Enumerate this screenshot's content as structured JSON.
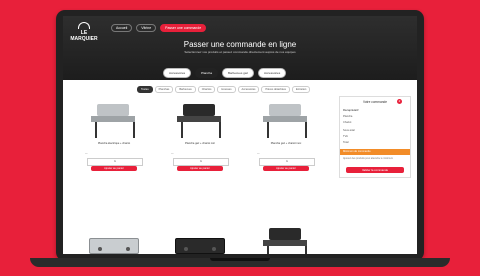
{
  "header": {
    "logo": "LE MARQUIER",
    "nav": [
      "Accueil",
      "Vitrine",
      "Passer une commande"
    ],
    "title": "Passer une commande en ligne",
    "subtitle": "Sélectionnez vos produits et passez commande directement auprès de nos équipes"
  },
  "tabs": [
    "Accessoires",
    "Plancha",
    "Barbecues gaz",
    "Accessoires"
  ],
  "filters": [
    "Toutes",
    "Planchas",
    "Barbecues",
    "Chariots",
    "Housses",
    "Accessoires",
    "Pièces détachées",
    "Entretien"
  ],
  "products": [
    {
      "title": "Plancha électrique + chariot",
      "price": "—",
      "qty": "1",
      "button": "Ajouter au panier"
    },
    {
      "title": "Plancha gaz + chariot noir",
      "price": "—",
      "qty": "1",
      "button": "Ajouter au panier"
    },
    {
      "title": "Plancha gaz + chariot inox",
      "price": "—",
      "qty": "1",
      "button": "Ajouter au panier"
    }
  ],
  "cart": {
    "title": "Votre commande",
    "count": "2",
    "section": "Récapitulatif",
    "lines": [
      {
        "label": "Plancha",
        "value": ""
      },
      {
        "label": "Chariot",
        "value": ""
      },
      {
        "label": "Sous-total",
        "value": ""
      },
      {
        "label": "TVA",
        "value": ""
      },
      {
        "label": "Total",
        "value": ""
      }
    ],
    "alert": "Minimum de commande",
    "note": "Ajoutez des produits pour atteindre le minimum",
    "button": "Valider la commande"
  }
}
